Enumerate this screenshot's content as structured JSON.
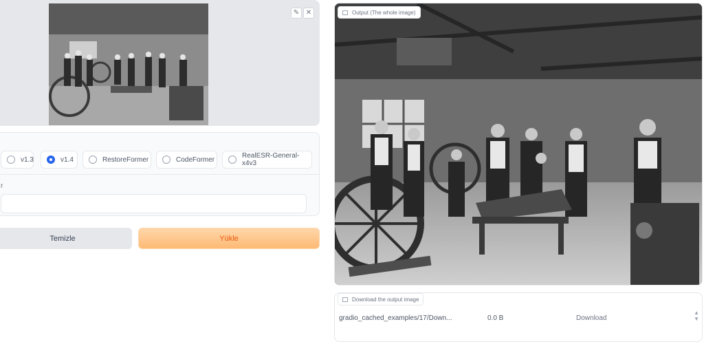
{
  "input": {
    "edit_icon": "pencil-icon",
    "close_icon": "close-icon"
  },
  "version_options": {
    "selected": "v1.4",
    "items": [
      {
        "label": "v1.3"
      },
      {
        "label": "v1.4"
      },
      {
        "label": "RestoreFormer"
      },
      {
        "label": "CodeFormer"
      },
      {
        "label": "RealESR-General-x4v3"
      }
    ]
  },
  "field": {
    "label": "r",
    "value": ""
  },
  "buttons": {
    "clear": "Temizle",
    "submit": "Yükle"
  },
  "output": {
    "label": "Output (The whole image)",
    "icon": "image-icon"
  },
  "download": {
    "label": "Download the output image",
    "icon": "file-icon",
    "file_name": "gradio_cached_examples/17/Down...",
    "file_size": "0.0 B",
    "link_label": "Download"
  },
  "colors": {
    "accent": "#2563eb",
    "submit_bg": "#fdba74",
    "submit_text": "#ea580c"
  }
}
